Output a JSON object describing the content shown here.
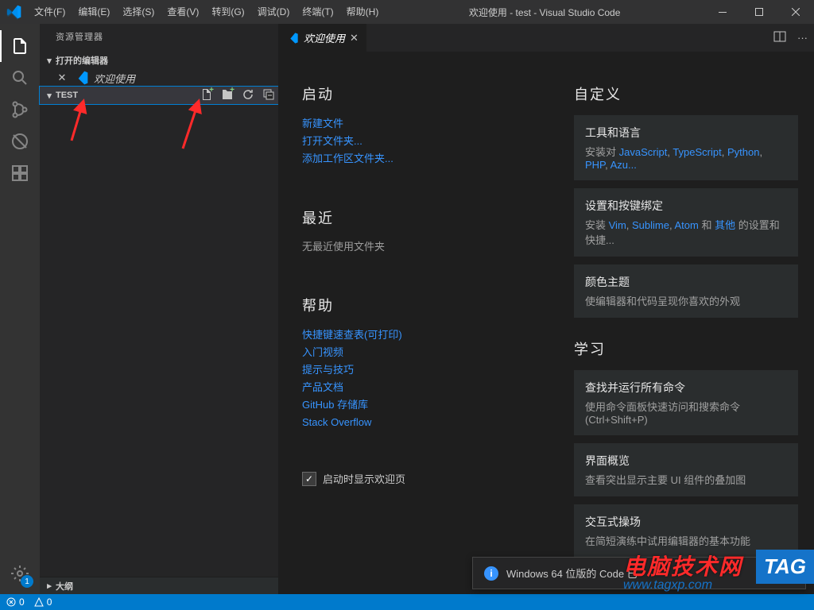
{
  "titlebar": {
    "menus": [
      "文件(F)",
      "编辑(E)",
      "选择(S)",
      "查看(V)",
      "转到(G)",
      "调试(D)",
      "终端(T)",
      "帮助(H)"
    ],
    "title": "欢迎使用 - test - Visual Studio Code"
  },
  "activitybar": {
    "settings_badge": "1"
  },
  "sidebar": {
    "title": "资源管理器",
    "open_editors_label": "打开的编辑器",
    "open_editor_item": "欢迎使用",
    "folder_label": "TEST",
    "outline_label": "大纲"
  },
  "tab": {
    "label": "欢迎使用"
  },
  "welcome": {
    "start_h": "启动",
    "start_links": [
      "新建文件",
      "打开文件夹...",
      "添加工作区文件夹..."
    ],
    "recent_h": "最近",
    "recent_text": "无最近使用文件夹",
    "help_h": "帮助",
    "help_links": [
      "快捷键速查表(可打印)",
      "入门视频",
      "提示与技巧",
      "产品文档",
      "GitHub 存储库",
      "Stack Overflow"
    ],
    "show_on_start": "启动时显示欢迎页",
    "custom_h": "自定义",
    "card1_t": "工具和语言",
    "card1_prefix": "安装对 ",
    "card1_links": [
      "JavaScript",
      "TypeScript",
      "Python",
      "PHP",
      "Azu..."
    ],
    "card2_t": "设置和按键绑定",
    "card2_prefix": "安装 ",
    "card2_links": [
      "Vim",
      "Sublime",
      "Atom"
    ],
    "card2_mid": " 和 ",
    "card2_link_other": "其他",
    "card2_suffix": " 的设置和快捷...",
    "card3_t": "颜色主题",
    "card3_d": "使编辑器和代码呈现你喜欢的外观",
    "learn_h": "学习",
    "card4_t": "查找并运行所有命令",
    "card4_d": "使用命令面板快速访问和搜索命令 (Ctrl+Shift+P)",
    "card5_t": "界面概览",
    "card5_d": "查看突出显示主要 UI 组件的叠加图",
    "card6_t": "交互式操场",
    "card6_d": "在简短演练中试用编辑器的基本功能"
  },
  "notification": {
    "text": "Windows 64 位版的 Code 已"
  },
  "statusbar": {
    "errors": "0",
    "warnings": "0"
  },
  "watermark": {
    "line1": "电脑技术网",
    "line2": "www.tagxp.com",
    "tag": "TAG"
  }
}
